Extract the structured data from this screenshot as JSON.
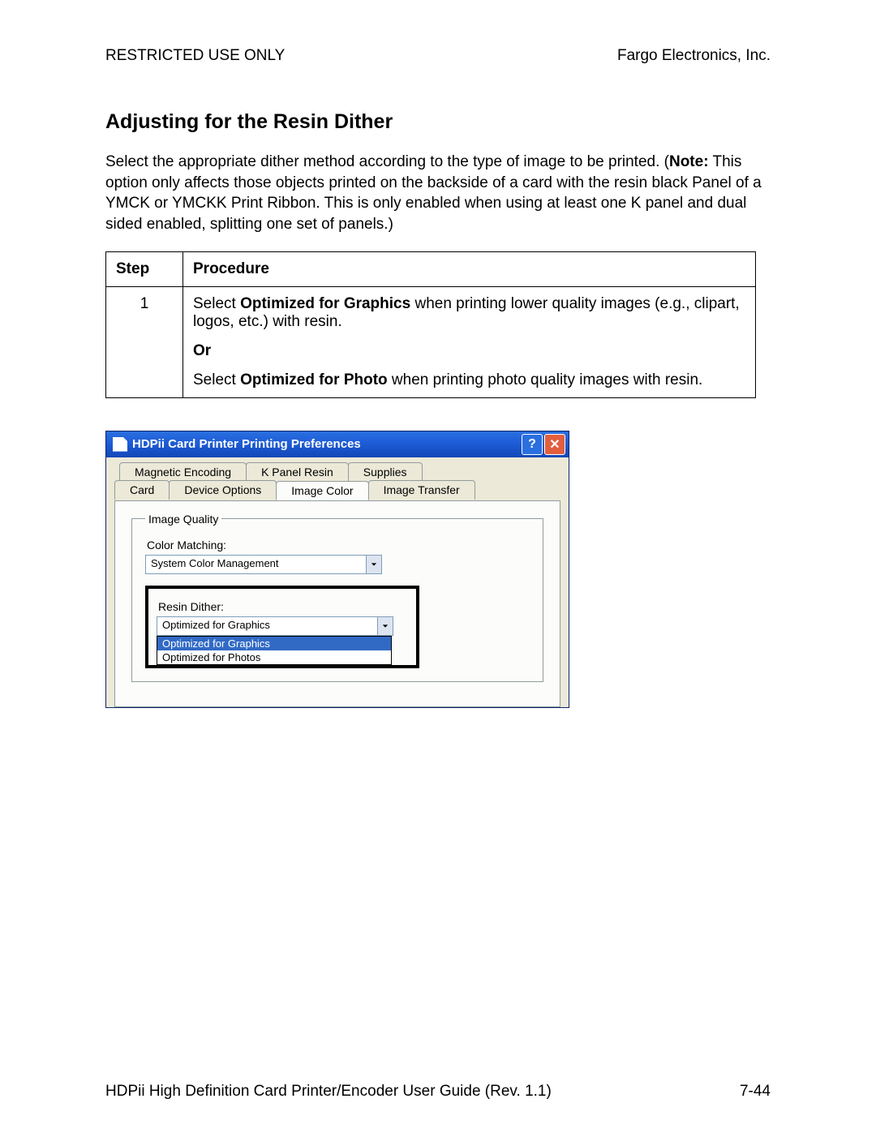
{
  "header": {
    "left": "RESTRICTED USE ONLY",
    "right": "Fargo Electronics, Inc."
  },
  "title": "Adjusting for the Resin Dither",
  "intro": {
    "pre": "Select the appropriate dither method according to the type of image to be printed. (",
    "note_label": "Note:",
    "post": " This option only affects those objects printed on the backside of a card with the resin black Panel of a YMCK or YMCKK Print Ribbon. This is only enabled when using at least one K panel and dual sided enabled, splitting one set of panels.)"
  },
  "table": {
    "headers": {
      "step": "Step",
      "proc": "Procedure"
    },
    "row": {
      "num": "1",
      "p1_a": "Select ",
      "p1_b": "Optimized for Graphics",
      "p1_c": " when printing lower quality images (e.g., clipart, logos, etc.) with resin.",
      "or": "Or",
      "p2_a": "Select ",
      "p2_b": "Optimized for Photo",
      "p2_c": " when printing photo quality images with resin."
    }
  },
  "dialog": {
    "title": "HDPii Card Printer Printing Preferences",
    "tabs_back": [
      "Magnetic Encoding",
      "K Panel Resin",
      "Supplies"
    ],
    "tabs_front": [
      "Card",
      "Device Options",
      "Image Color",
      "Image Transfer"
    ],
    "active_tab": "Image Color",
    "group_title": "Image Quality",
    "color_label": "Color Matching:",
    "color_value": "System Color Management",
    "resin_label": "Resin Dither:",
    "resin_value": "Optimized for Graphics",
    "resin_options": [
      "Optimized for Graphics",
      "Optimized for Photos"
    ]
  },
  "footer": {
    "left": "HDPii High Definition Card Printer/Encoder User Guide (Rev. 1.1)",
    "right": "7-44"
  }
}
